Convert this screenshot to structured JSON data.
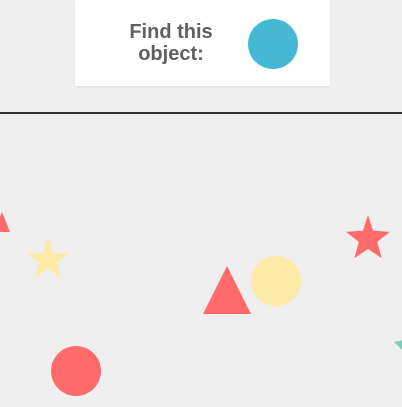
{
  "prompt": {
    "label": "Find this object:",
    "target": {
      "shape": "circle",
      "color": "#45b8d4",
      "icon": "target-circle-icon"
    }
  },
  "colors": {
    "background": "#efefef",
    "card": "#ffffff",
    "text": "#606060",
    "divider": "#333333",
    "red": "#ff6b6b",
    "yellow": "#ffeaa7",
    "teal": "#7fcdbb",
    "blue": "#45b8d4"
  },
  "field_objects": [
    {
      "name": "red-triangle-partial-left",
      "shape": "triangle",
      "color": "#ff6b6b"
    },
    {
      "name": "yellow-star",
      "shape": "star",
      "color": "#ffeaa7"
    },
    {
      "name": "red-triangle",
      "shape": "triangle",
      "color": "#ff6b6b"
    },
    {
      "name": "yellow-circle",
      "shape": "circle",
      "color": "#ffeaa7"
    },
    {
      "name": "red-star",
      "shape": "star",
      "color": "#ff6b6b"
    },
    {
      "name": "red-circle",
      "shape": "circle",
      "color": "#ff6b6b"
    },
    {
      "name": "teal-shape-partial-right",
      "shape": "triangle",
      "color": "#7fcdbb"
    }
  ]
}
